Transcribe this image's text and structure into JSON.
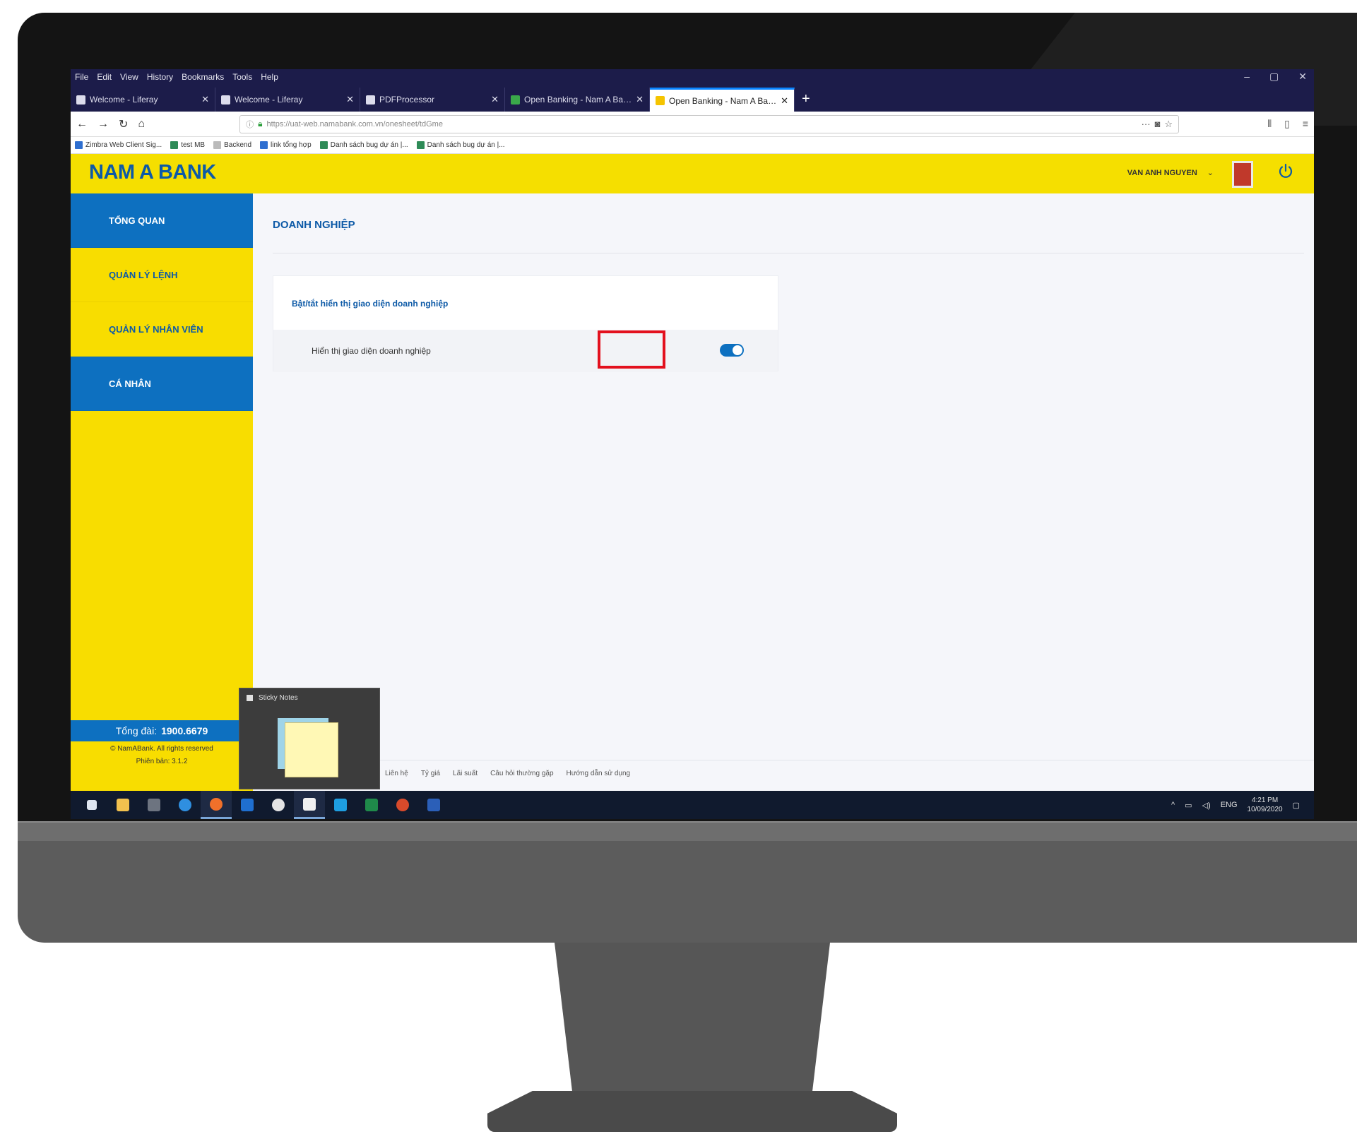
{
  "browser": {
    "menu": [
      "File",
      "Edit",
      "View",
      "History",
      "Bookmarks",
      "Tools",
      "Help"
    ],
    "window_controls": [
      "–",
      "▢",
      "✕"
    ],
    "tabs": [
      {
        "label": "Welcome - Liferay",
        "active": false
      },
      {
        "label": "Welcome - Liferay",
        "active": false
      },
      {
        "label": "PDFProcessor",
        "active": false
      },
      {
        "label": "Open Banking - Nam A Bank",
        "active": false
      },
      {
        "label": "Open Banking - Nam A Bank",
        "active": true
      }
    ],
    "new_tab": "+",
    "url": "https://uat-web.namabank.com.vn/onesheet/tdGme",
    "bookmarks": [
      "Zimbra Web Client Sig...",
      "test MB",
      "Backend",
      "link tổng hợp",
      "Danh sách bug dự án |...",
      "Danh sách bug dự án |..."
    ]
  },
  "app": {
    "brand": "NAM A BANK",
    "user_name": "VAN ANH NGUYEN",
    "colors": {
      "brand_yellow": "#f5df00",
      "brand_blue": "#0d70c0",
      "highlight_red": "#e3101e"
    },
    "sidebar": [
      {
        "label": "TỔNG QUAN",
        "active": true
      },
      {
        "label": "QUẢN LÝ LỆNH",
        "active": false
      },
      {
        "label": "QUẢN LÝ NHÂN VIÊN",
        "active": false
      },
      {
        "label": "CÁ NHÂN",
        "active": true
      }
    ],
    "hotline_label": "Tổng đài:",
    "hotline_number": "1900.6679",
    "copyright": "© NamABank. All rights reserved",
    "version": "Phiên bản: 3.1.2",
    "page_title": "DOANH NGHIỆP",
    "card_title": "Bật/tắt hiển thị giao diện doanh nghiệp",
    "setting_label": "Hiển thị giao diện doanh nghiệp",
    "setting_enabled": true,
    "footer_links": [
      "Liên hệ",
      "Tỷ giá",
      "Lãi suất",
      "Câu hỏi thường gặp",
      "Hướng dẫn sử dụng"
    ]
  },
  "sticky_notes": {
    "title": "Sticky Notes"
  },
  "taskbar": {
    "time": "4:21 PM",
    "date": "10/09/2020",
    "lang": "ENG"
  }
}
